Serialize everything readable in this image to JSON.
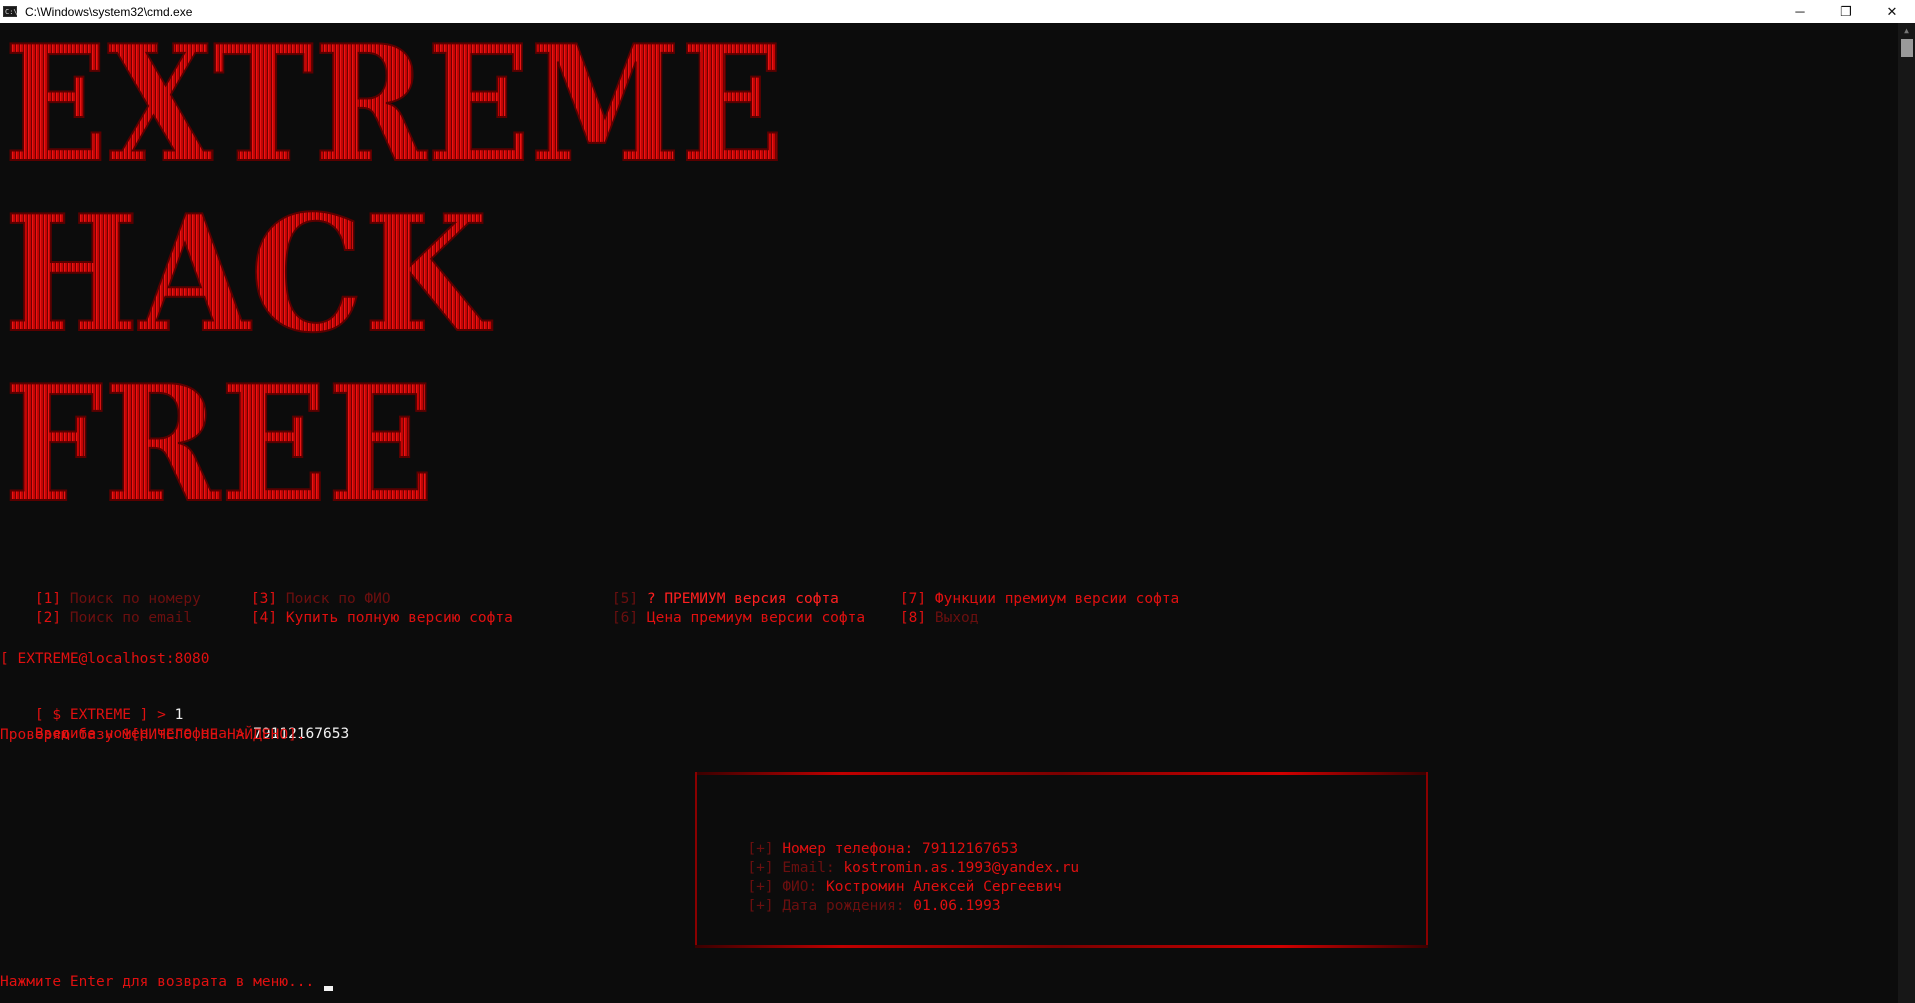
{
  "window": {
    "title": "C:\\Windows\\system32\\cmd.exe",
    "minimize_glyph": "─",
    "restore_glyph": "❐",
    "close_glyph": "✕"
  },
  "banner": {
    "lines": [
      "EXTREME",
      "HACK",
      "FREE"
    ]
  },
  "menu": {
    "items": [
      {
        "key": "[1]",
        "label": "Поиск по номеру"
      },
      {
        "key": "[2]",
        "label": "Поиск по email"
      },
      {
        "key": "[3]",
        "label": "Поиск по ФИО"
      },
      {
        "key": "[4]",
        "label": "Купить полную версию софта"
      },
      {
        "key": "[5]",
        "label": "? ПРЕМИУМ версия софта"
      },
      {
        "key": "[6]",
        "label": "Цена премиум версии софта"
      },
      {
        "key": "[7]",
        "label": "Функции премиум версии софта"
      },
      {
        "key": "[8]",
        "label": "Выход"
      }
    ]
  },
  "host_line": "[ EXTREME@localhost:8080",
  "prompt": {
    "prefix": "[ $ EXTREME ] >",
    "input": "1"
  },
  "phone_prompt": {
    "label": "Введите номер телефона >",
    "value": "79112167653"
  },
  "check_line": "Проверяю базу 1[НИЧЕГО НЕ НАЙДЕНО].",
  "result": {
    "lines": [
      {
        "prefix": "[+]",
        "label": "Номер телефона:",
        "value": "79112167653"
      },
      {
        "prefix": "[+]",
        "label": "Email:",
        "value": "kostromin.as.1993@yandex.ru"
      },
      {
        "prefix": "[+]",
        "label": "ФИО:",
        "value": "Костромин Алексей Сергеевич"
      },
      {
        "prefix": "[+]",
        "label": "Дата рождения:",
        "value": "01.06.1993"
      }
    ]
  },
  "footer": "Нажмите Enter для возврата в меню...",
  "colors": {
    "background": "#0c0c0c",
    "red": "#e01010",
    "dim_red": "#6b0f0f",
    "white": "#f2f2f2"
  }
}
